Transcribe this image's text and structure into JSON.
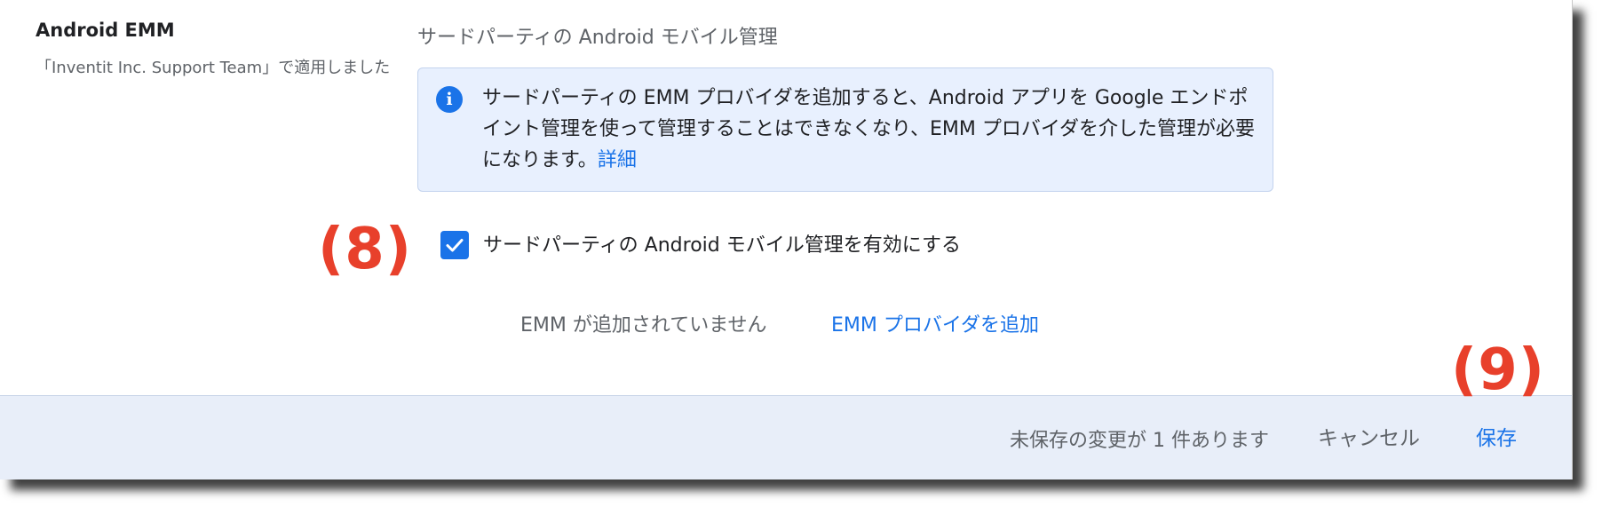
{
  "settings": {
    "title": "Android EMM",
    "applied_note": "「Inventit Inc. Support Team」で適用しました"
  },
  "section": {
    "heading": "サードパーティの Android モバイル管理"
  },
  "info": {
    "icon": "info-icon",
    "icon_glyph": "i",
    "message": "サードパーティの EMM プロバイダを追加すると、Android アプリを Google エンドポイント管理を使って管理することはできなくなり、EMM プロバイダを介した管理が必要になります。",
    "link_label": "詳細"
  },
  "enable_option": {
    "checked": true,
    "label": "サードパーティの Android モバイル管理を有効にする"
  },
  "emm": {
    "status": "EMM が追加されていません",
    "add_label": "EMM プロバイダを追加"
  },
  "annotations": {
    "checkbox_marker": "(8)",
    "save_marker": "(9)"
  },
  "footer": {
    "unsaved_message": "未保存の変更が 1 件あります",
    "cancel_label": "キャンセル",
    "save_label": "保存"
  },
  "colors": {
    "accent": "#1a73e8",
    "annotation": "#e8402b",
    "info_background": "#e8f0fe",
    "footer_background": "#e8eef9"
  }
}
